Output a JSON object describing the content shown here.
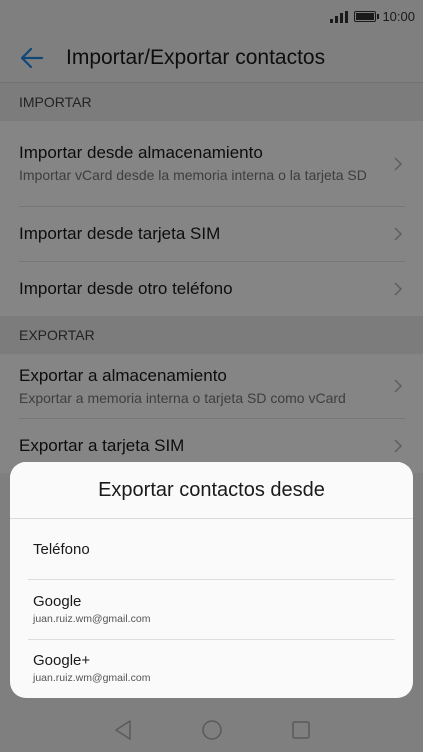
{
  "status_bar": {
    "time": "10:00"
  },
  "app_bar": {
    "title": "Importar/Exportar contactos"
  },
  "sections": {
    "import_header": "IMPORTAR",
    "export_header": "EXPORTAR"
  },
  "import_items": [
    {
      "title": "Importar desde almacenamiento",
      "subtitle": "Importar vCard desde la memoria interna o la tarjeta SD"
    },
    {
      "title": "Importar desde tarjeta SIM"
    },
    {
      "title": "Importar desde otro teléfono"
    }
  ],
  "export_items": [
    {
      "title": "Exportar a almacenamiento",
      "subtitle": "Exportar a memoria interna o tarjeta SD como vCard"
    },
    {
      "title": "Exportar a tarjeta SIM"
    }
  ],
  "dialog": {
    "title": "Exportar contactos desde",
    "options": [
      {
        "title": "Teléfono"
      },
      {
        "title": "Google",
        "subtitle": "juan.ruiz.wm@gmail.com"
      },
      {
        "title": "Google+",
        "subtitle": "juan.ruiz.wm@gmail.com"
      }
    ]
  },
  "icons": {
    "back": "arrow-left-icon",
    "chevron": "chevron-right-icon",
    "nav_back": "triangle-back-icon",
    "nav_home": "circle-home-icon",
    "nav_recents": "square-recents-icon"
  },
  "colors": {
    "accent": "#1e88e5",
    "scrim": "rgba(0,0,0,0.48)"
  }
}
